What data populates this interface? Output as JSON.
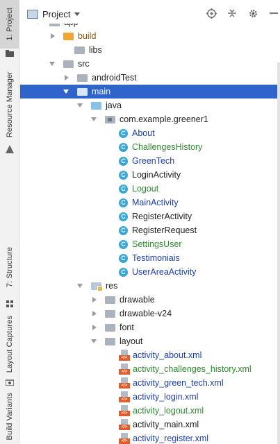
{
  "sidebar": {
    "tabs": [
      {
        "key": "project",
        "label": "1: Project",
        "active": true,
        "icon": "folder-icon"
      },
      {
        "key": "resource",
        "label": "Resource Manager",
        "active": false,
        "icon": "resource-icon"
      },
      {
        "key": "structure",
        "label": "7: Structure",
        "active": false,
        "icon": "structure-icon"
      },
      {
        "key": "layout_captures",
        "label": "Layout Captures",
        "active": false,
        "icon": "camera-icon"
      },
      {
        "key": "build_variants",
        "label": "Build Variants",
        "active": false,
        "icon": "build-icon"
      }
    ]
  },
  "header": {
    "title": "Project",
    "icons": [
      "target-icon",
      "collapse-icon",
      "gear-icon",
      "minimize-icon"
    ]
  },
  "tree": {
    "items": [
      {
        "label": "app",
        "arrow": "down",
        "icon": "folder-gray"
      },
      {
        "label": "build",
        "arrow": "right",
        "icon": "folder-orange"
      },
      {
        "label": "libs",
        "arrow": "none",
        "icon": "folder-gray"
      },
      {
        "label": "src",
        "arrow": "down",
        "icon": "folder-gray"
      },
      {
        "label": "androidTest",
        "arrow": "right",
        "icon": "folder-gray"
      },
      {
        "label": "main",
        "arrow": "down",
        "icon": "folder-gray",
        "selected": true
      },
      {
        "label": "java",
        "arrow": "down",
        "icon": "folder-blue"
      },
      {
        "label": "com.example.greener1",
        "arrow": "down",
        "icon": "package"
      },
      {
        "label": "About",
        "icon": "class",
        "color": "blue"
      },
      {
        "label": "ChallengesHistory",
        "icon": "class",
        "color": "green"
      },
      {
        "label": "GreenTech",
        "icon": "class",
        "color": "blue"
      },
      {
        "label": "LoginActivity",
        "icon": "class",
        "color": "dark"
      },
      {
        "label": "Logout",
        "icon": "class",
        "color": "green"
      },
      {
        "label": "MainActivity",
        "icon": "class",
        "color": "blue"
      },
      {
        "label": "RegisterActivity",
        "icon": "class",
        "color": "dark"
      },
      {
        "label": "RegisterRequest",
        "icon": "class",
        "color": "dark"
      },
      {
        "label": "SettingsUser",
        "icon": "class",
        "color": "green"
      },
      {
        "label": "Testimoniais",
        "icon": "class",
        "color": "blue"
      },
      {
        "label": "UserAreaActivity",
        "icon": "class",
        "color": "blue"
      },
      {
        "label": "res",
        "arrow": "down",
        "icon": "folder-res"
      },
      {
        "label": "drawable",
        "arrow": "right",
        "icon": "folder-gray"
      },
      {
        "label": "drawable-v24",
        "arrow": "right",
        "icon": "folder-gray"
      },
      {
        "label": "font",
        "arrow": "right",
        "icon": "folder-gray"
      },
      {
        "label": "layout",
        "arrow": "down",
        "icon": "folder-gray"
      },
      {
        "label": "activity_about.xml",
        "icon": "xml",
        "color": "blue"
      },
      {
        "label": "activity_challenges_history.xml",
        "icon": "xml",
        "color": "green"
      },
      {
        "label": "activity_green_tech.xml",
        "icon": "xml",
        "color": "blue"
      },
      {
        "label": "activity_login.xml",
        "icon": "xml",
        "color": "blue"
      },
      {
        "label": "activity_logout.xml",
        "icon": "xml",
        "color": "green"
      },
      {
        "label": "activity_main.xml",
        "icon": "xml",
        "color": "dark"
      },
      {
        "label": "activity_register.xml",
        "icon": "xml",
        "color": "blue"
      }
    ]
  },
  "colors": {
    "selection": "#2f65ca",
    "green_text": "#2e8a2e",
    "blue_text": "#1e3fae",
    "class_icon": "#39a6d8",
    "xml_icon": "#e25b2a"
  }
}
